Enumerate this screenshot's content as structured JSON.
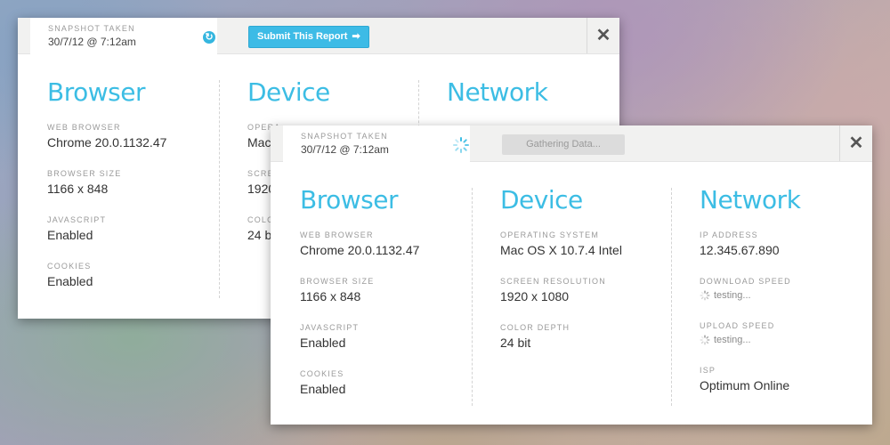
{
  "back_panel": {
    "snapshot_label": "SNAPSHOT TAKEN",
    "snapshot_time": "30/7/12 @ 7:12am",
    "submit_label": "Submit This Report",
    "close_label": "✕",
    "browser": {
      "title": "Browser",
      "fields": [
        {
          "label": "WEB BROWSER",
          "value": "Chrome 20.0.1132.47"
        },
        {
          "label": "BROWSER SIZE",
          "value": "1166 x 848"
        },
        {
          "label": "JAVASCRIPT",
          "value": "Enabled"
        },
        {
          "label": "COOKIES",
          "value": "Enabled"
        }
      ]
    },
    "device": {
      "title": "Device",
      "fields": [
        {
          "label": "OPERA",
          "value": "Mac"
        },
        {
          "label": "SCRE",
          "value": "1920"
        },
        {
          "label": "COLO",
          "value": "24 b"
        }
      ]
    },
    "network": {
      "title": "Network"
    }
  },
  "front_panel": {
    "snapshot_label": "SNAPSHOT TAKEN",
    "snapshot_time": "30/7/12 @ 7:12am",
    "gathering_label": "Gathering Data...",
    "close_label": "✕",
    "browser": {
      "title": "Browser",
      "fields": [
        {
          "label": "WEB BROWSER",
          "value": "Chrome 20.0.1132.47"
        },
        {
          "label": "BROWSER SIZE",
          "value": "1166 x 848"
        },
        {
          "label": "JAVASCRIPT",
          "value": "Enabled"
        },
        {
          "label": "COOKIES",
          "value": "Enabled"
        }
      ]
    },
    "device": {
      "title": "Device",
      "fields": [
        {
          "label": "OPERATING SYSTEM",
          "value": "Mac OS X 10.7.4 Intel"
        },
        {
          "label": "SCREEN RESOLUTION",
          "value": "1920 x 1080"
        },
        {
          "label": "COLOR DEPTH",
          "value": "24 bit"
        }
      ]
    },
    "network": {
      "title": "Network",
      "fields": [
        {
          "label": "IP ADDRESS",
          "value": "12.345.67.890"
        },
        {
          "label": "DOWNLOAD SPEED",
          "value": "testing..."
        },
        {
          "label": "UPLOAD SPEED",
          "value": "testing..."
        },
        {
          "label": "ISP",
          "value": "Optimum Online"
        }
      ]
    }
  },
  "icons": {
    "refresh": "refresh-icon",
    "spinner": "spinner-icon",
    "close": "close-icon",
    "arrow": "arrow-right-icon"
  },
  "colors": {
    "accent": "#3cbde4",
    "button": "#3dbbe6",
    "header_bg": "#f1f1f0"
  }
}
